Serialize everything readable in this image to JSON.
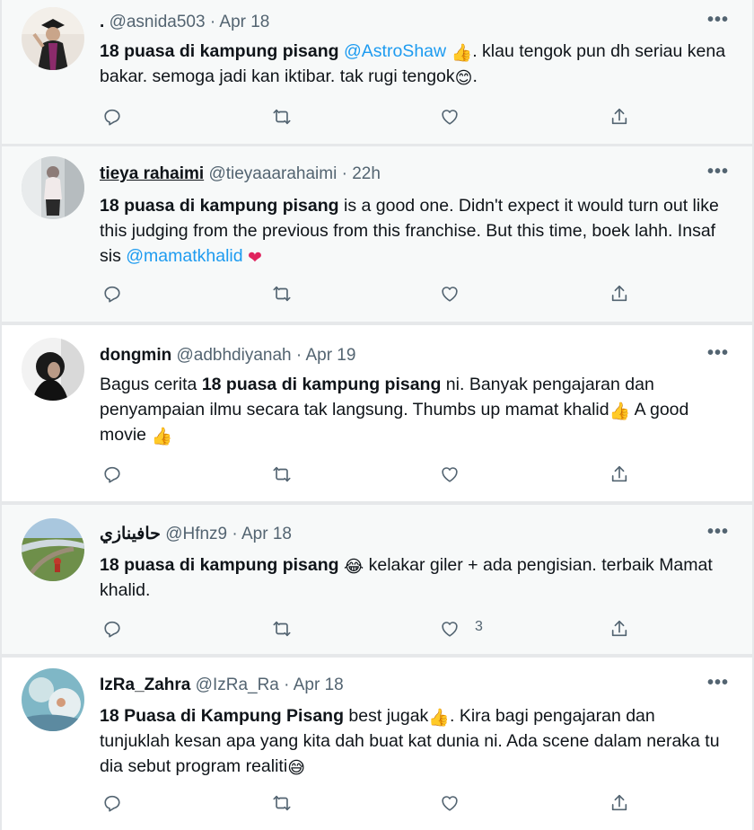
{
  "tweets": [
    {
      "display_name": ".",
      "handle": "@asnida503",
      "date": "Apr 18",
      "segments": [
        {
          "t": "18 puasa di kampung pisang",
          "s": "bold"
        },
        {
          "t": " "
        },
        {
          "t": "@AstroShaw",
          "s": "mention"
        },
        {
          "t": " "
        },
        {
          "t": "👍",
          "s": "emoji thumb"
        },
        {
          "t": ". klau tengok pun dh seriau kena bakar. semoga jadi kan iktibar. tak rugi tengok"
        },
        {
          "t": "😊",
          "s": "emoji"
        },
        {
          "t": "."
        }
      ],
      "like_count": ""
    },
    {
      "display_name": "tieya rahaimi",
      "handle": "@tieyaaarahaimi",
      "date": "22h",
      "segments": [
        {
          "t": "18 puasa di kampung pisang",
          "s": "bold"
        },
        {
          "t": " is a good one. Didn't expect it would turn out like this judging from the previous from this franchise. But this time, boek lahh. Insaf sis "
        },
        {
          "t": "@mamatkhalid",
          "s": "mention"
        },
        {
          "t": " "
        },
        {
          "t": "❤",
          "s": "emoji heart-e"
        }
      ],
      "like_count": ""
    },
    {
      "display_name": "dongmin",
      "handle": "@adbhdiyanah",
      "date": "Apr 19",
      "segments": [
        {
          "t": "Bagus cerita "
        },
        {
          "t": "18 puasa di kampung pisang",
          "s": "bold"
        },
        {
          "t": " ni. Banyak pengajaran dan penyampaian ilmu secara tak langsung. Thumbs up mamat khalid"
        },
        {
          "t": "👍",
          "s": "emoji thumb light"
        },
        {
          "t": " A good movie "
        },
        {
          "t": "👍",
          "s": "emoji thumb light"
        }
      ],
      "like_count": ""
    },
    {
      "display_name": "حافينازي",
      "handle": "@Hfnz9",
      "date": "Apr 18",
      "segments": [
        {
          "t": "18 puasa di kampung pisang",
          "s": "bold"
        },
        {
          "t": " "
        },
        {
          "t": "😂",
          "s": "emoji"
        },
        {
          "t": " kelakar giler + ada pengisian. terbaik Mamat khalid."
        }
      ],
      "like_count": "3"
    },
    {
      "display_name": "IzRa_Zahra",
      "handle": "@IzRa_Ra",
      "date": "Apr 18",
      "segments": [
        {
          "t": "18 Puasa di Kampung Pisang",
          "s": "bold"
        },
        {
          "t": " best jugak"
        },
        {
          "t": "👍",
          "s": "emoji thumb"
        },
        {
          "t": ". Kira bagi pengajaran dan tunjuklah kesan apa yang kita dah buat kat dunia ni. Ada scene dalam neraka tu dia sebut program realiti"
        },
        {
          "t": "😅",
          "s": "emoji"
        }
      ],
      "like_count": ""
    }
  ],
  "icons": {
    "more": "more-horizontal-icon",
    "reply": "reply-icon",
    "retweet": "retweet-icon",
    "like": "heart-icon",
    "share": "share-icon"
  },
  "colors": {
    "mention": "#1d9bf0",
    "secondary_text": "#536471",
    "highlight_bg": "#f7f9f9"
  }
}
